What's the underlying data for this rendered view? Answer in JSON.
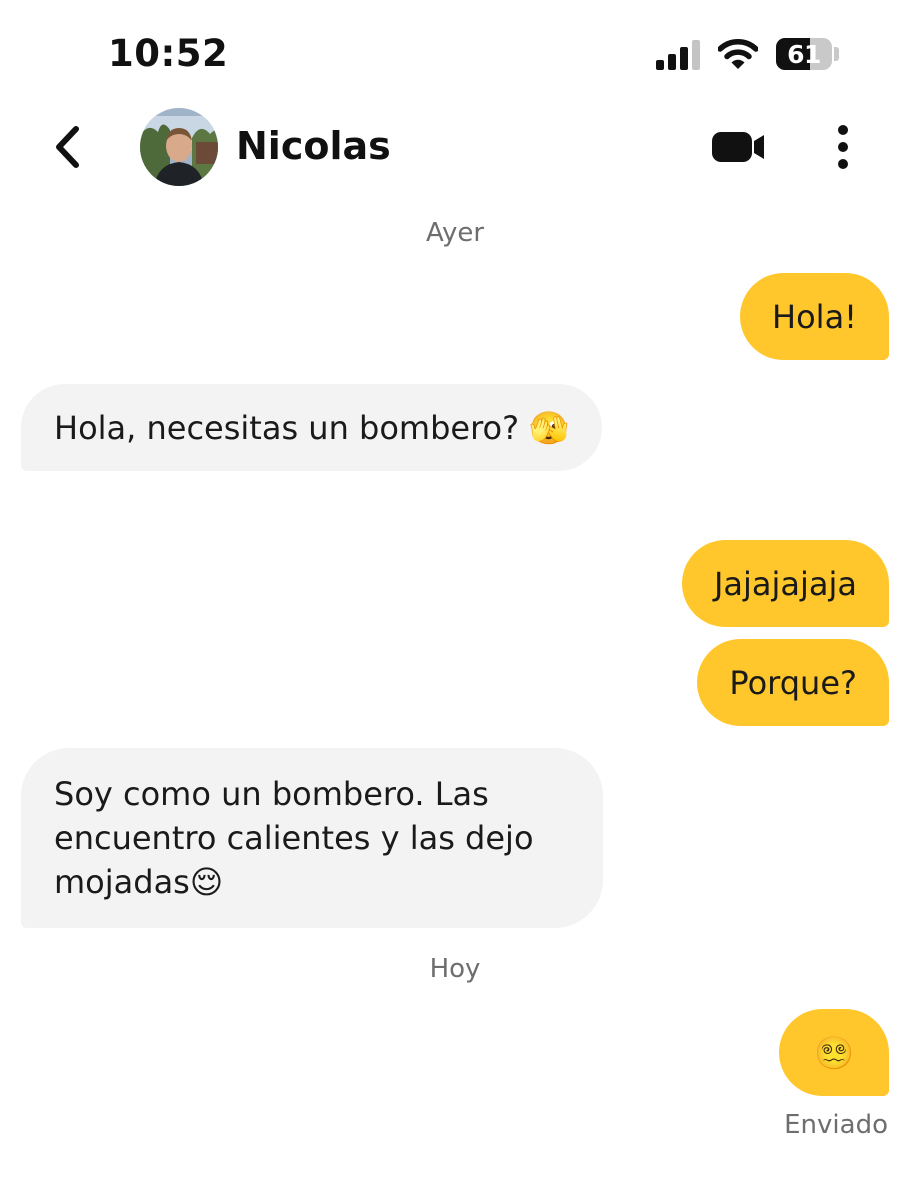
{
  "status_bar": {
    "time": "10:52",
    "battery_level": "61"
  },
  "header": {
    "back_icon": "chevron-left-icon",
    "contact_name": "Nicolas",
    "video_icon": "video-camera-icon",
    "more_icon": "more-vertical-icon"
  },
  "chat": {
    "day_1": "Ayer",
    "messages_day_1": [
      {
        "direction": "out",
        "text": "Hola!"
      },
      {
        "direction": "in",
        "text": "Hola, necesitas un bombero? 🫣"
      },
      {
        "direction": "out",
        "text": "Jajajajaja"
      },
      {
        "direction": "out",
        "text": "Porque?"
      },
      {
        "direction": "in",
        "text": "Soy como un bombero. Las encuentro calientes y las dejo mojadas😌"
      }
    ],
    "day_2": "Hoy",
    "messages_day_2": [
      {
        "direction": "out",
        "text": "😵‍💫"
      }
    ],
    "last_message_status": "Enviado"
  },
  "colors": {
    "outgoing_bubble": "#ffc72c",
    "incoming_bubble": "#f3f3f3",
    "secondary_text": "#6e6e6e"
  }
}
